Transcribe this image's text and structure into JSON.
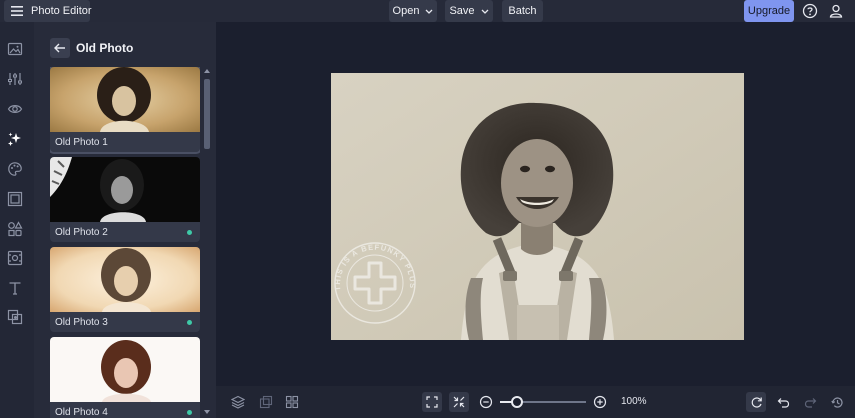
{
  "app": {
    "title": "Photo Editor"
  },
  "toolbar": {
    "open_label": "Open",
    "save_label": "Save",
    "batch_label": "Batch",
    "upgrade_label": "Upgrade"
  },
  "rail": {
    "icons": [
      "image-icon",
      "sliders-icon",
      "eye-icon",
      "effects-icon",
      "palette-icon",
      "frame-icon",
      "graphics-icon",
      "texture-icon",
      "text-icon",
      "overlay-icon"
    ],
    "active_index": 3
  },
  "panel": {
    "title": "Old Photo",
    "items": [
      {
        "label": "Old Photo 1",
        "pro": false,
        "selected": true
      },
      {
        "label": "Old Photo 2",
        "pro": true,
        "selected": false
      },
      {
        "label": "Old Photo 3",
        "pro": true,
        "selected": false
      },
      {
        "label": "Old Photo 4",
        "pro": true,
        "selected": false
      }
    ]
  },
  "watermark": {
    "text": "THIS IS A BEFUNKY PLUS FEATURE"
  },
  "zoom": {
    "value_label": "100%",
    "level": 0.2
  },
  "colors": {
    "accent": "#7f95ef",
    "pro_dot": "#3ec9a7",
    "background": "#1b1f2e",
    "panel": "#272b3a"
  }
}
